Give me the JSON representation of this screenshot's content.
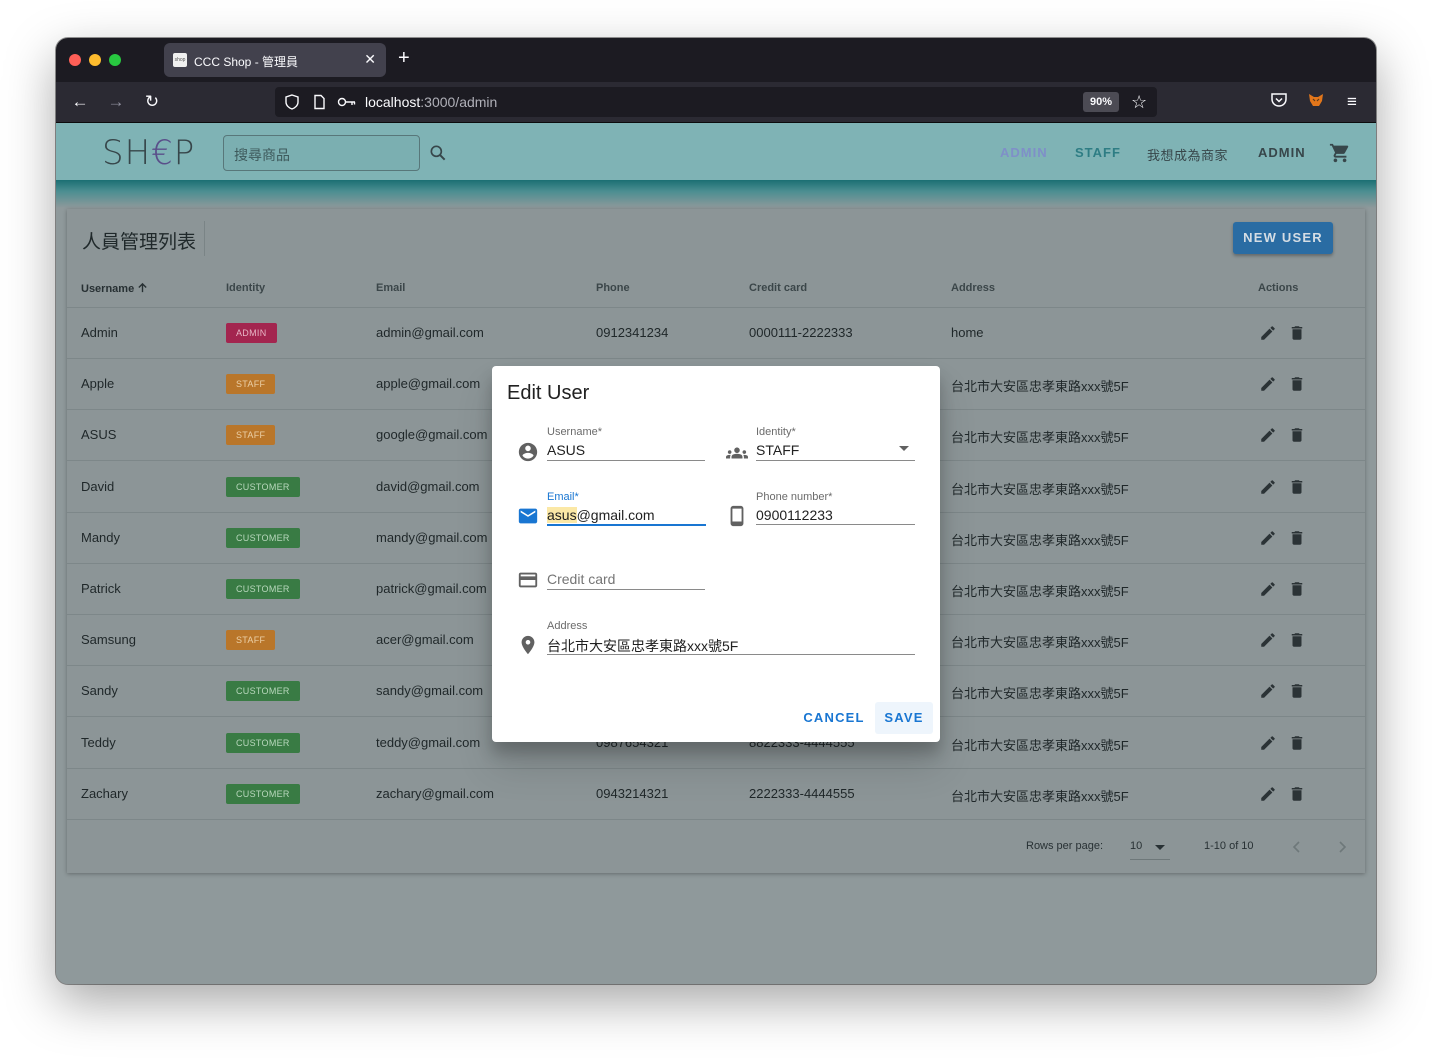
{
  "browser": {
    "tab_title": "CCC Shop - 管理員",
    "url_host": "localhost",
    "url_path": ":3000/admin",
    "zoom": "90%"
  },
  "header": {
    "logo": "SHEP",
    "search_placeholder": "搜尋商品",
    "menu": [
      "ADMIN",
      "STAFF",
      "我想成為商家",
      "ADMIN"
    ]
  },
  "card": {
    "title": "人員管理列表",
    "new_user_label": "NEW USER"
  },
  "table": {
    "headers": [
      "Username",
      "Identity",
      "Email",
      "Phone",
      "Credit card",
      "Address",
      "Actions"
    ],
    "rows": [
      {
        "username": "Admin",
        "identity": "ADMIN",
        "email": "admin@gmail.com",
        "phone": "0912341234",
        "card": "0000111-2222333",
        "address": "home"
      },
      {
        "username": "Apple",
        "identity": "STAFF",
        "email": "apple@gmail.com",
        "phone": "",
        "card": "",
        "address": "台北市大安區忠孝東路xxx號5F"
      },
      {
        "username": "ASUS",
        "identity": "STAFF",
        "email": "google@gmail.com",
        "phone": "",
        "card": "",
        "address": "台北市大安區忠孝東路xxx號5F"
      },
      {
        "username": "David",
        "identity": "CUSTOMER",
        "email": "david@gmail.com",
        "phone": "",
        "card": "",
        "address": "台北市大安區忠孝東路xxx號5F"
      },
      {
        "username": "Mandy",
        "identity": "CUSTOMER",
        "email": "mandy@gmail.com",
        "phone": "",
        "card": "",
        "address": "台北市大安區忠孝東路xxx號5F"
      },
      {
        "username": "Patrick",
        "identity": "CUSTOMER",
        "email": "patrick@gmail.com",
        "phone": "",
        "card": "",
        "address": "台北市大安區忠孝東路xxx號5F"
      },
      {
        "username": "Samsung",
        "identity": "STAFF",
        "email": "acer@gmail.com",
        "phone": "",
        "card": "",
        "address": "台北市大安區忠孝東路xxx號5F"
      },
      {
        "username": "Sandy",
        "identity": "CUSTOMER",
        "email": "sandy@gmail.com",
        "phone": "",
        "card": "",
        "address": "台北市大安區忠孝東路xxx號5F"
      },
      {
        "username": "Teddy",
        "identity": "CUSTOMER",
        "email": "teddy@gmail.com",
        "phone": "0987654321",
        "card": "8822333-4444555",
        "address": "台北市大安區忠孝東路xxx號5F"
      },
      {
        "username": "Zachary",
        "identity": "CUSTOMER",
        "email": "zachary@gmail.com",
        "phone": "0943214321",
        "card": "2222333-4444555",
        "address": "台北市大安區忠孝東路xxx號5F"
      }
    ],
    "footer": {
      "rows_per_page_label": "Rows per page:",
      "rows_per_page": "10",
      "range": "1-10 of 10"
    }
  },
  "dialog": {
    "title": "Edit User",
    "username_label": "Username*",
    "username": "ASUS",
    "identity_label": "Identity*",
    "identity": "STAFF",
    "email_label": "Email*",
    "email_highlight": "asus",
    "email_rest": "@gmail.com",
    "phone_label": "Phone number*",
    "phone": "0900112233",
    "credit_card_placeholder": "Credit card",
    "address_label": "Address",
    "address": "台北市大安區忠孝東路xxx號5F",
    "cancel_label": "CANCEL",
    "save_label": "SAVE"
  },
  "colors": {
    "accent": "#1976d2",
    "admin_badge": "#d81b60",
    "staff_badge": "#f5911e",
    "customer_badge": "#4caf50",
    "header_bg": "#7fb3b5"
  },
  "icons": [
    "search-icon",
    "cart-icon",
    "edit-icon",
    "delete-icon",
    "account-circle-icon",
    "people-icon",
    "mail-icon",
    "phone-icon",
    "credit-card-icon",
    "location-icon",
    "sort-arrow-up-icon",
    "chevron-left-icon",
    "chevron-right-icon"
  ]
}
